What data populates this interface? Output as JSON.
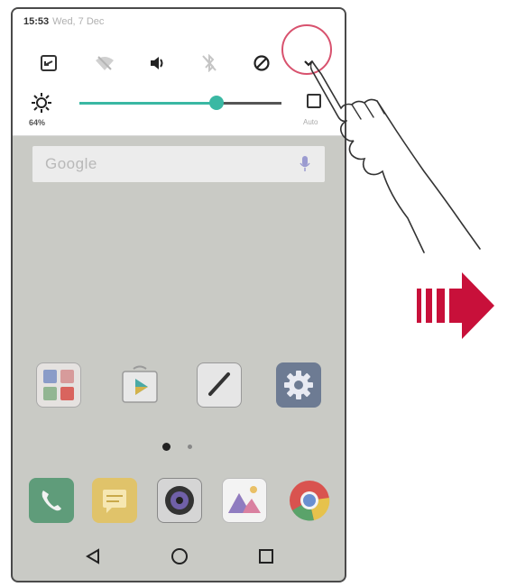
{
  "status_bar": {
    "time": "15:53",
    "date": "Wed, 7 Dec"
  },
  "quick_settings": {
    "toggles": [
      {
        "name": "screen-rotation-icon"
      },
      {
        "name": "wifi-off-icon"
      },
      {
        "name": "sound-icon"
      },
      {
        "name": "bluetooth-off-icon"
      },
      {
        "name": "do-not-disturb-icon"
      },
      {
        "name": "expand-chevron-icon"
      }
    ],
    "brightness": {
      "value_label": "64%",
      "level": 0.68,
      "auto_label": "Auto"
    }
  },
  "search": {
    "logo_text": "Google"
  },
  "home_apps": [
    {
      "name": "google-folder-icon"
    },
    {
      "name": "play-store-icon"
    },
    {
      "name": "notes-pen-icon"
    },
    {
      "name": "settings-gear-icon"
    }
  ],
  "dock_apps": [
    {
      "name": "phone-icon"
    },
    {
      "name": "messages-icon"
    },
    {
      "name": "camera-icon"
    },
    {
      "name": "gallery-icon"
    },
    {
      "name": "chrome-icon"
    }
  ],
  "navigation": [
    "back-icon",
    "home-icon",
    "recents-icon"
  ],
  "colors": {
    "accent_teal": "#3ab8a3",
    "highlight_ring": "#d8526e",
    "arrow_red": "#c8103a"
  }
}
